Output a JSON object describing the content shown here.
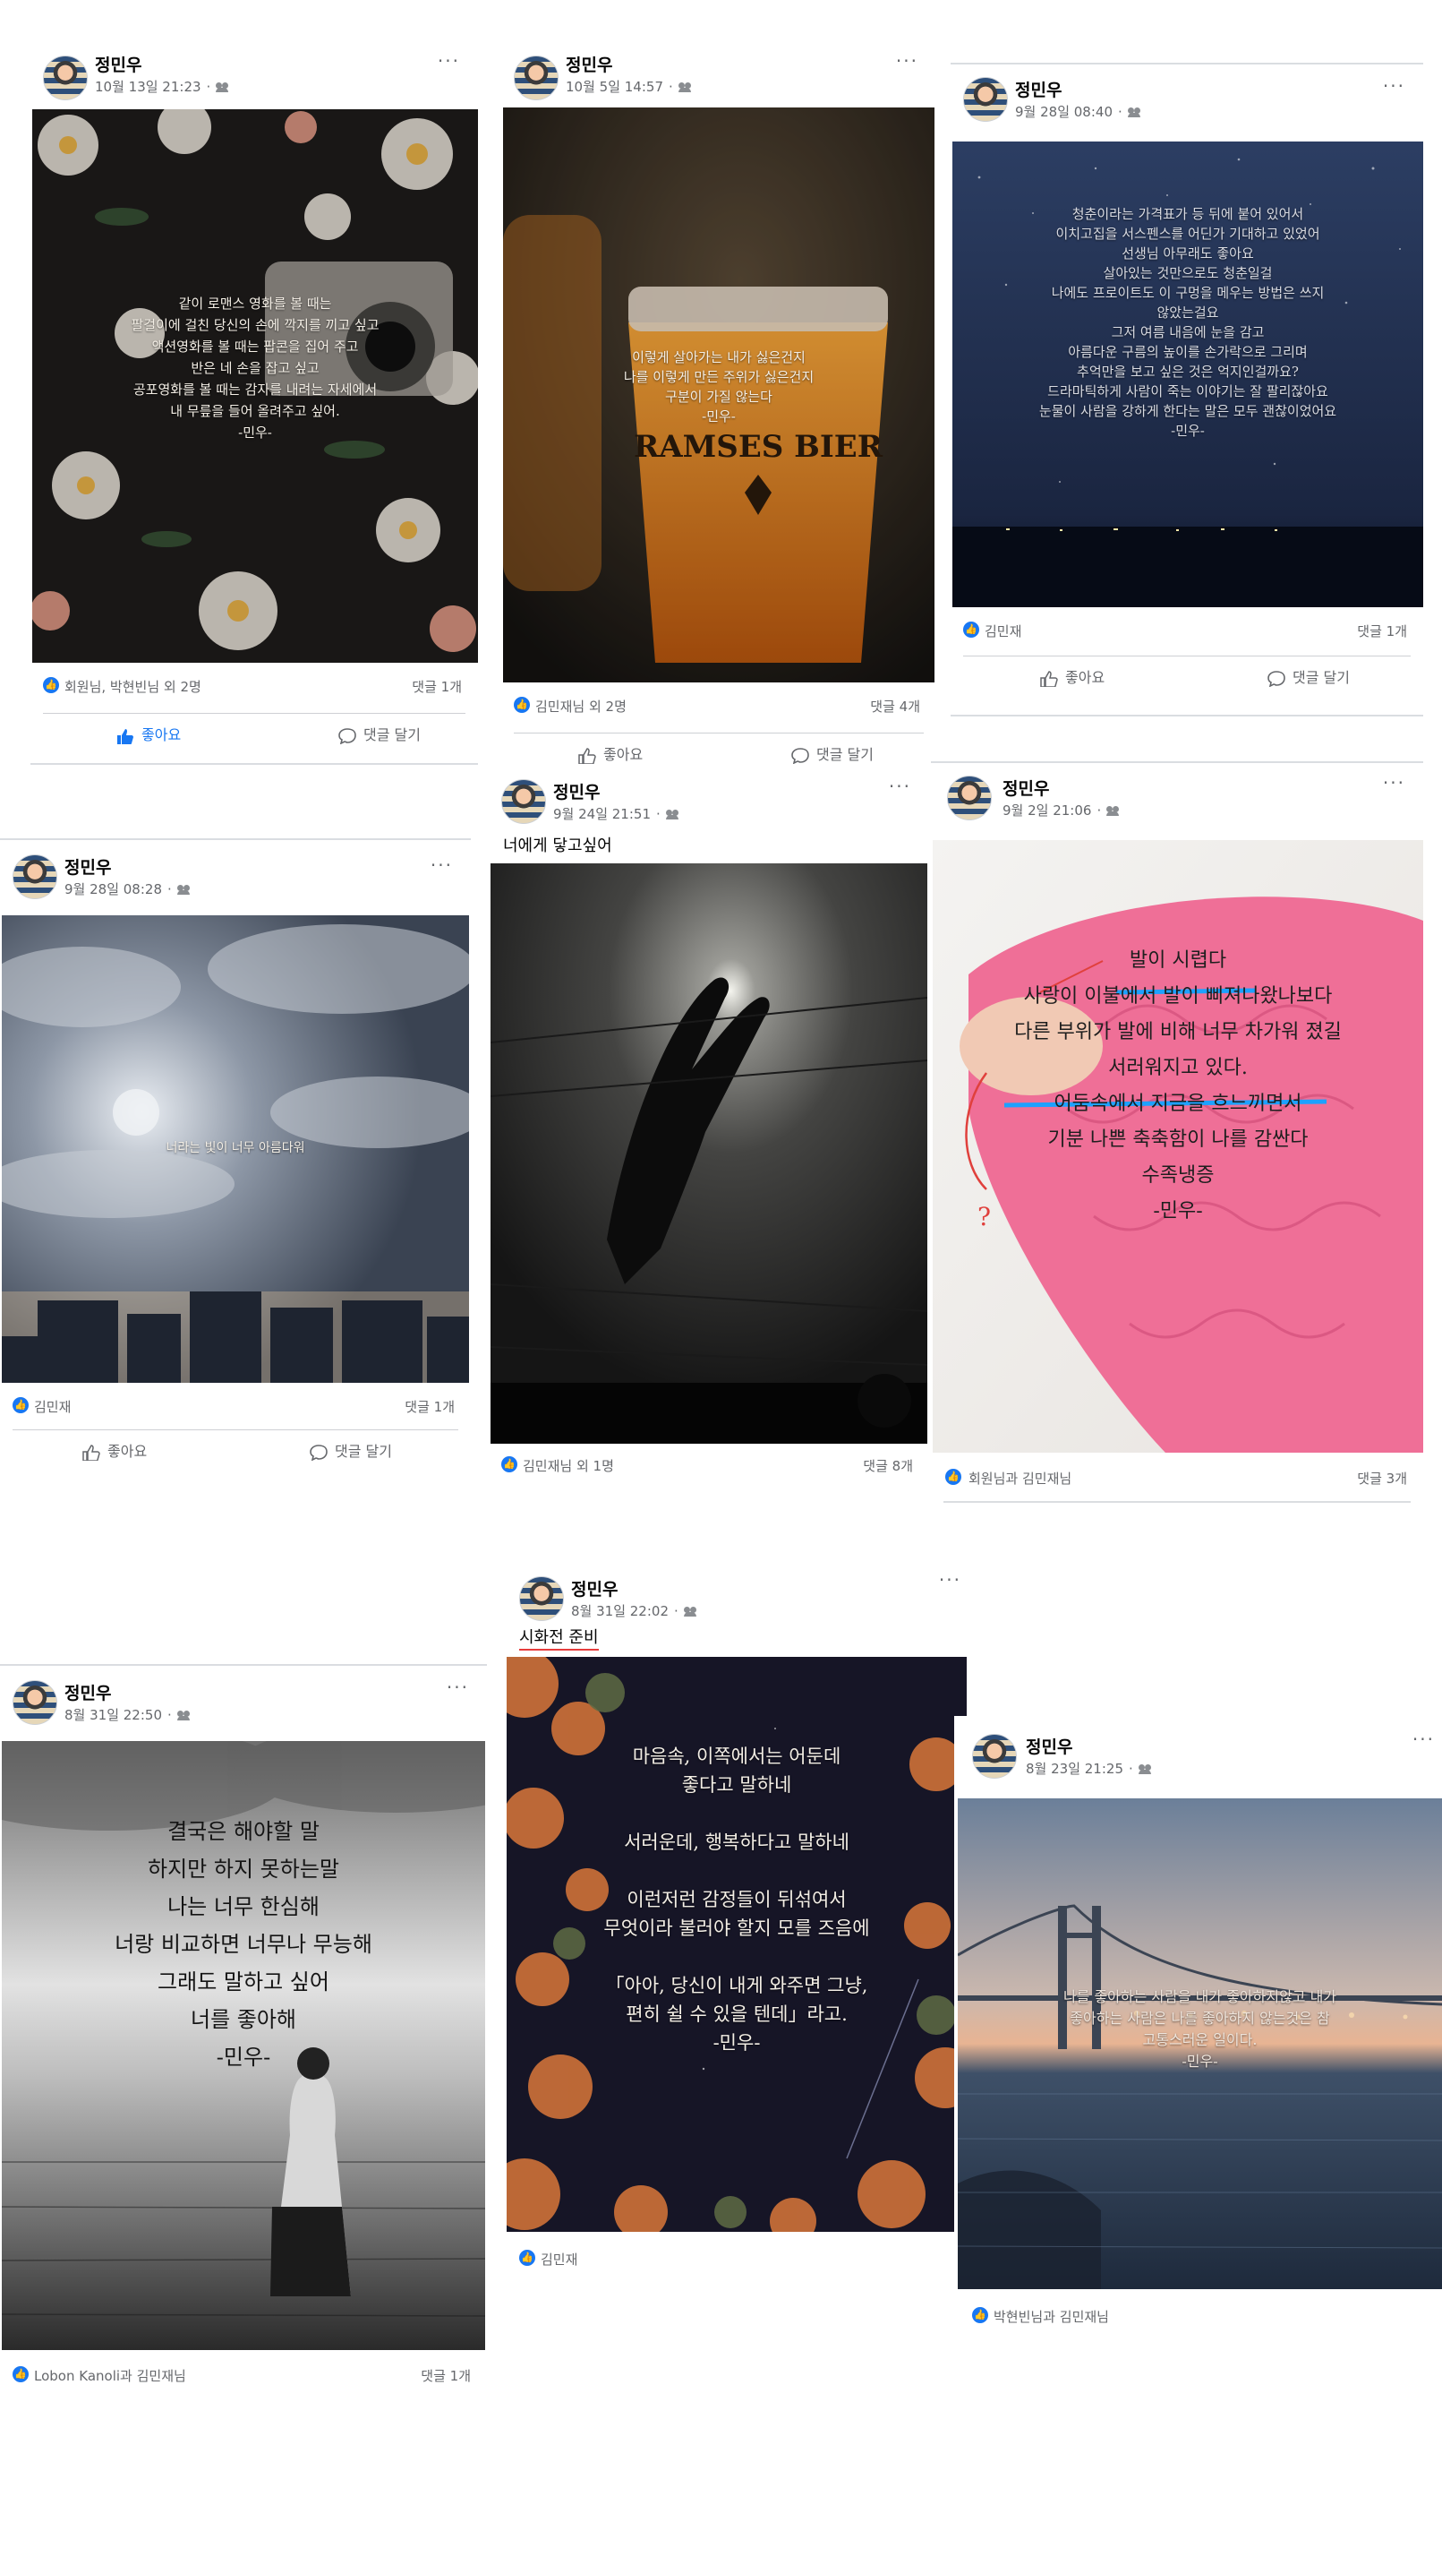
{
  "posts": [
    {
      "author": "정민우",
      "time": "10월 13일 21:23",
      "caption": "",
      "overlay": "같이 로맨스 영화를 볼 때는\n팔걸이에 걸친 당신의 손에 깍지를 끼고 싶고\n액션영화를 볼 때는 팝콘을 집어 주고\n반은 네 손을 잡고 싶고\n공포영화를 볼 때는 감자를 내려는 자세에서\n내 무릎을 들어 올려주고 싶어.\n-민우-",
      "reactions": "회원님, 박현빈님 외 2명",
      "comments": "댓글 1개",
      "like_label": "좋아요",
      "comment_label": "댓글 달기"
    },
    {
      "author": "정민우",
      "time": "10월 5일 14:57",
      "caption": "",
      "overlay": "이렇게 살아가는 내가 싫은건지\n나를 이렇게 만든 주위가 싫은건지\n구분이 가질 않는다\n-민우-",
      "brand": "RAMSES BIER",
      "reactions": "김민재님 외 2명",
      "comments": "댓글 4개",
      "like_label": "좋아요",
      "comment_label": "댓글 달기"
    },
    {
      "author": "정민우",
      "time": "9월 28일 08:40",
      "caption": "",
      "overlay": "청춘이라는 가격표가 등 뒤에 붙어 있어서\n이치고집을 서스펜스를 어딘가 기대하고 있었어\n선생님 아무래도 좋아요\n살아있는 것만으로도 청춘일걸\n나에도 프로이트도 이 구멍을 메우는 방법은 쓰지\n않았는걸요\n그저 여름 내음에 눈을 감고\n아름다운 구름의 높이를 손가락으로 그리며\n추억만을 보고 싶은 것은 억지인걸까요?\n드라마틱하게 사람이 죽는 이야기는 잘 팔리잖아요\n눈물이 사람을 강하게 한다는 말은 모두 괜찮이었어요\n-민우-",
      "reactions": "김민재",
      "comments": "댓글 1개",
      "like_label": "좋아요",
      "comment_label": "댓글 달기"
    },
    {
      "author": "정민우",
      "time": "9월 28일 08:28",
      "caption": "",
      "overlay": "너라는 빛이 너무 아름다워",
      "reactions": "김민재",
      "comments": "댓글 1개",
      "like_label": "좋아요",
      "comment_label": "댓글 달기"
    },
    {
      "author": "정민우",
      "time": "9월 24일 21:51",
      "caption": "너에게 닿고싶어",
      "overlay": "",
      "reactions": "김민재님 외 1명",
      "comments": "댓글 8개"
    },
    {
      "author": "정민우",
      "time": "9월 2일 21:06",
      "caption": "",
      "overlay": "발이 시렵다\n사랑이 이불에서 발이 삐져나왔나보다\n다른 부위가 발에 비해 너무 차가워 졌길\n서러워지고 있다.\n어둠속에서 지금을 흐느끼면서\n기분 나쁜 축축함이 나를 감싼다\n수족냉증\n-민우-",
      "reactions": "회원님과 김민재님",
      "comments": "댓글 3개"
    },
    {
      "author": "정민우",
      "time": "8월 31일 22:50",
      "caption": "",
      "overlay": "결국은 해야할 말\n하지만 하지 못하는말\n나는 너무 한심해\n너랑 비교하면 너무나 무능해\n그래도 말하고 싶어\n너를 좋아해\n-민우-",
      "reactions": "Lobon Kanoli과 김민재님",
      "comments": "댓글 1개"
    },
    {
      "author": "정민우",
      "time": "8월 31일 22:02",
      "caption": "시화전 준비",
      "overlay": "마음속, 이쪽에서는 어둔데\n좋다고 말하네\n\n서러운데, 행복하다고 말하네\n\n이런저런 감정들이 뒤섞여서\n무엇이라 불러야 할지 모를 즈음에\n\n「아아, 당신이 내게 와주면 그냥,\n편히 쉴 수 있을 텐데」라고.\n-민우-",
      "reactions": "김민재",
      "comments": ""
    },
    {
      "author": "정민우",
      "time": "8월 23일 21:25",
      "caption": "",
      "overlay": "나를 좋아하는 사람을 내가 좋아하지않고 내가\n좋아하는 사람은 나를 좋아하지 않는것은 참\n고통스러운 일이다.\n-민우-",
      "reactions": "박현빈님과 김민재님",
      "comments": ""
    }
  ],
  "colors": {
    "accent": "#1877f2",
    "meta": "#65676b",
    "divider": "#dadde1"
  }
}
